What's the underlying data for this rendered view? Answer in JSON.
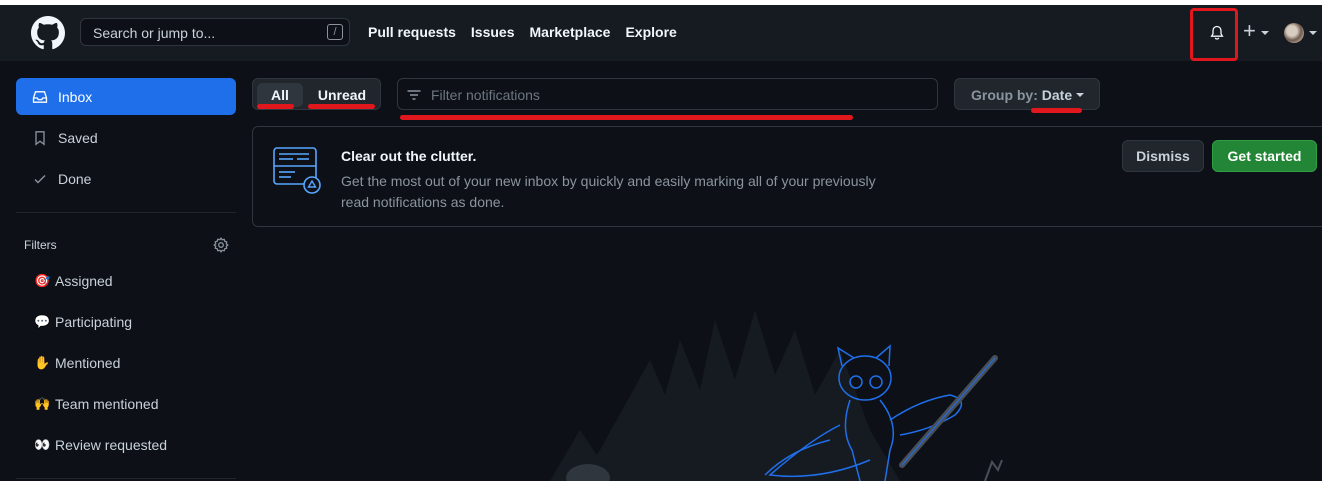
{
  "header": {
    "search_placeholder": "Search or jump to...",
    "search_shortcut": "/",
    "nav": [
      "Pull requests",
      "Issues",
      "Marketplace",
      "Explore"
    ],
    "plus_symbol": "+"
  },
  "sidebar": {
    "items": [
      {
        "label": "Inbox",
        "icon": "inbox-icon",
        "active": true
      },
      {
        "label": "Saved",
        "icon": "bookmark-icon"
      },
      {
        "label": "Done",
        "icon": "check-icon"
      }
    ],
    "filters_title": "Filters",
    "filters": [
      {
        "label": "Assigned",
        "emoji": "🎯"
      },
      {
        "label": "Participating",
        "emoji": "💬"
      },
      {
        "label": "Mentioned",
        "emoji": "✋"
      },
      {
        "label": "Team mentioned",
        "emoji": "🙌"
      },
      {
        "label": "Review requested",
        "emoji": "👀"
      }
    ]
  },
  "toolbar": {
    "all_label": "All",
    "unread_label": "Unread",
    "filter_placeholder": "Filter notifications",
    "group_by_label": "Group by:",
    "group_by_value": "Date"
  },
  "banner": {
    "title": "Clear out the clutter.",
    "description": "Get the most out of your new inbox by quickly and easily marking all of your previously read notifications as done.",
    "dismiss_label": "Dismiss",
    "start_label": "Get started"
  },
  "colors": {
    "accent_blue": "#1f6feb",
    "primary_green": "#238636",
    "annotation_red": "#e0171d",
    "header_bg": "#161b22",
    "page_bg": "#0d1117"
  }
}
